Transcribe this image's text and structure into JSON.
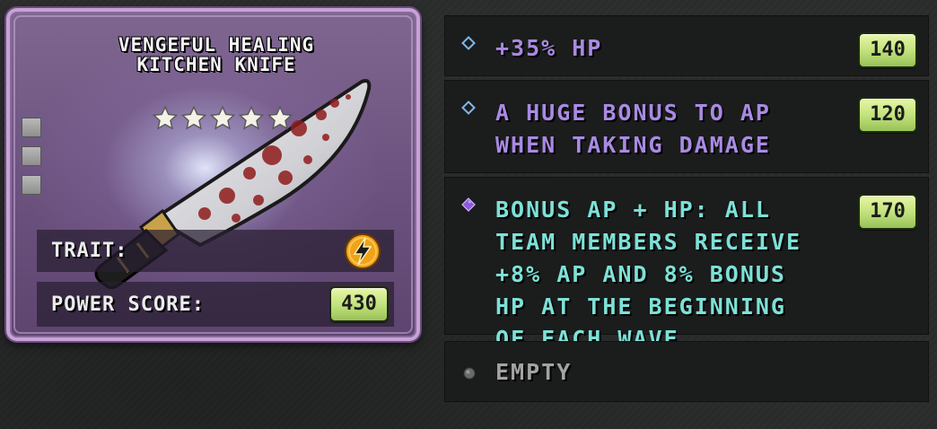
{
  "item": {
    "name": "VENGEFUL HEALING KITCHEN KNIFE",
    "stars": 5,
    "stars_max": 5,
    "upgrade_slots": 3,
    "trait_label": "TRAIT:",
    "trait_icon": "lightning-bolt-icon",
    "power_label": "POWER SCORE:",
    "power_value": "430",
    "rarity_color": "#c6a3d6"
  },
  "perks": [
    {
      "text": "+35% HP",
      "value": "140",
      "marker": "diamond-outline-icon",
      "text_color": "#a98ae3"
    },
    {
      "text": "A HUGE BONUS TO AP WHEN TAKING DAMAGE",
      "value": "120",
      "marker": "diamond-outline-icon",
      "text_color": "#a98ae3"
    },
    {
      "text": "BONUS AP + HP: ALL TEAM MEMBERS RECEIVE +8% AP AND 8% BONUS HP AT THE BEGINNING OF EACH WAVE",
      "value": "170",
      "marker": "diamond-filled-purple-icon",
      "text_color": "#7de1d7"
    },
    {
      "text": "EMPTY",
      "marker": "circle-gray-icon",
      "text_color": "#a3a3a3"
    }
  ],
  "colors": {
    "badge_green": "#bfe07a",
    "perk_background": "#1b1c1c",
    "card_purple": "#7f6690"
  }
}
